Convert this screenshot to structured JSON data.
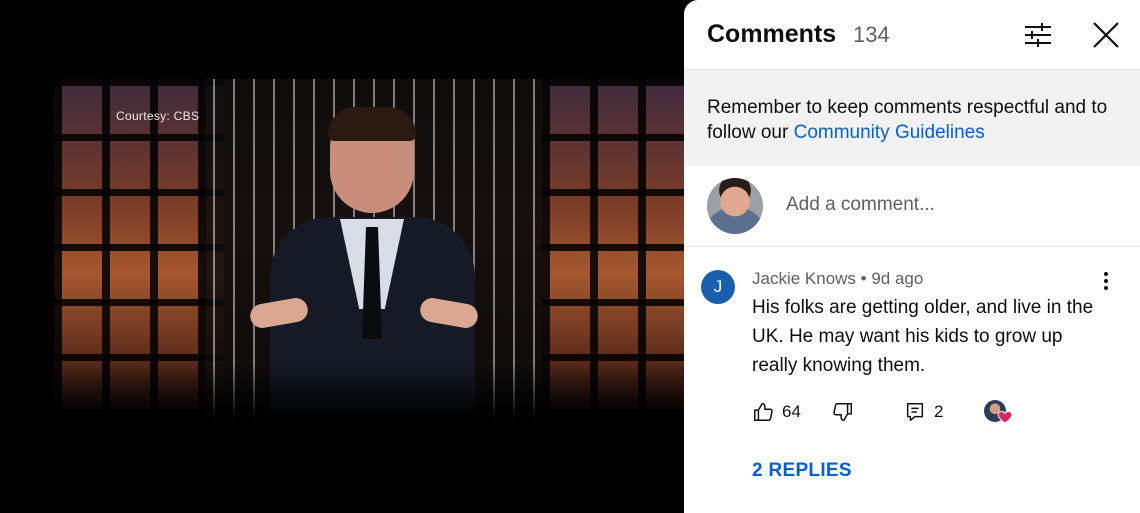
{
  "video": {
    "overlay_text": "Courtesy: CBS"
  },
  "comments_panel": {
    "title": "Comments",
    "count": "134",
    "guidelines_prefix": "Remember to keep comments respectful and to follow our ",
    "guidelines_link": "Community Guidelines",
    "add_comment_placeholder": "Add a comment...",
    "comment": {
      "avatar_letter": "J",
      "author": "Jackie Knows",
      "time": "9d ago",
      "text": "His  folks are getting older, and live in the UK.  He may want his kids to grow up really knowing them.",
      "likes": "64",
      "reply_count": "2",
      "replies_label": "2 REPLIES"
    }
  },
  "icons": {
    "filter": "filter-sliders-icon",
    "close": "close-icon",
    "more": "kebab-menu-icon",
    "like": "thumbs-up-icon",
    "dislike": "thumbs-down-icon",
    "reply": "reply-icon",
    "creator_heart": "creator-heart-icon"
  },
  "colors": {
    "link": "#065fd4",
    "avatar_j": "#1a5eae",
    "heart": "#e0245e"
  }
}
